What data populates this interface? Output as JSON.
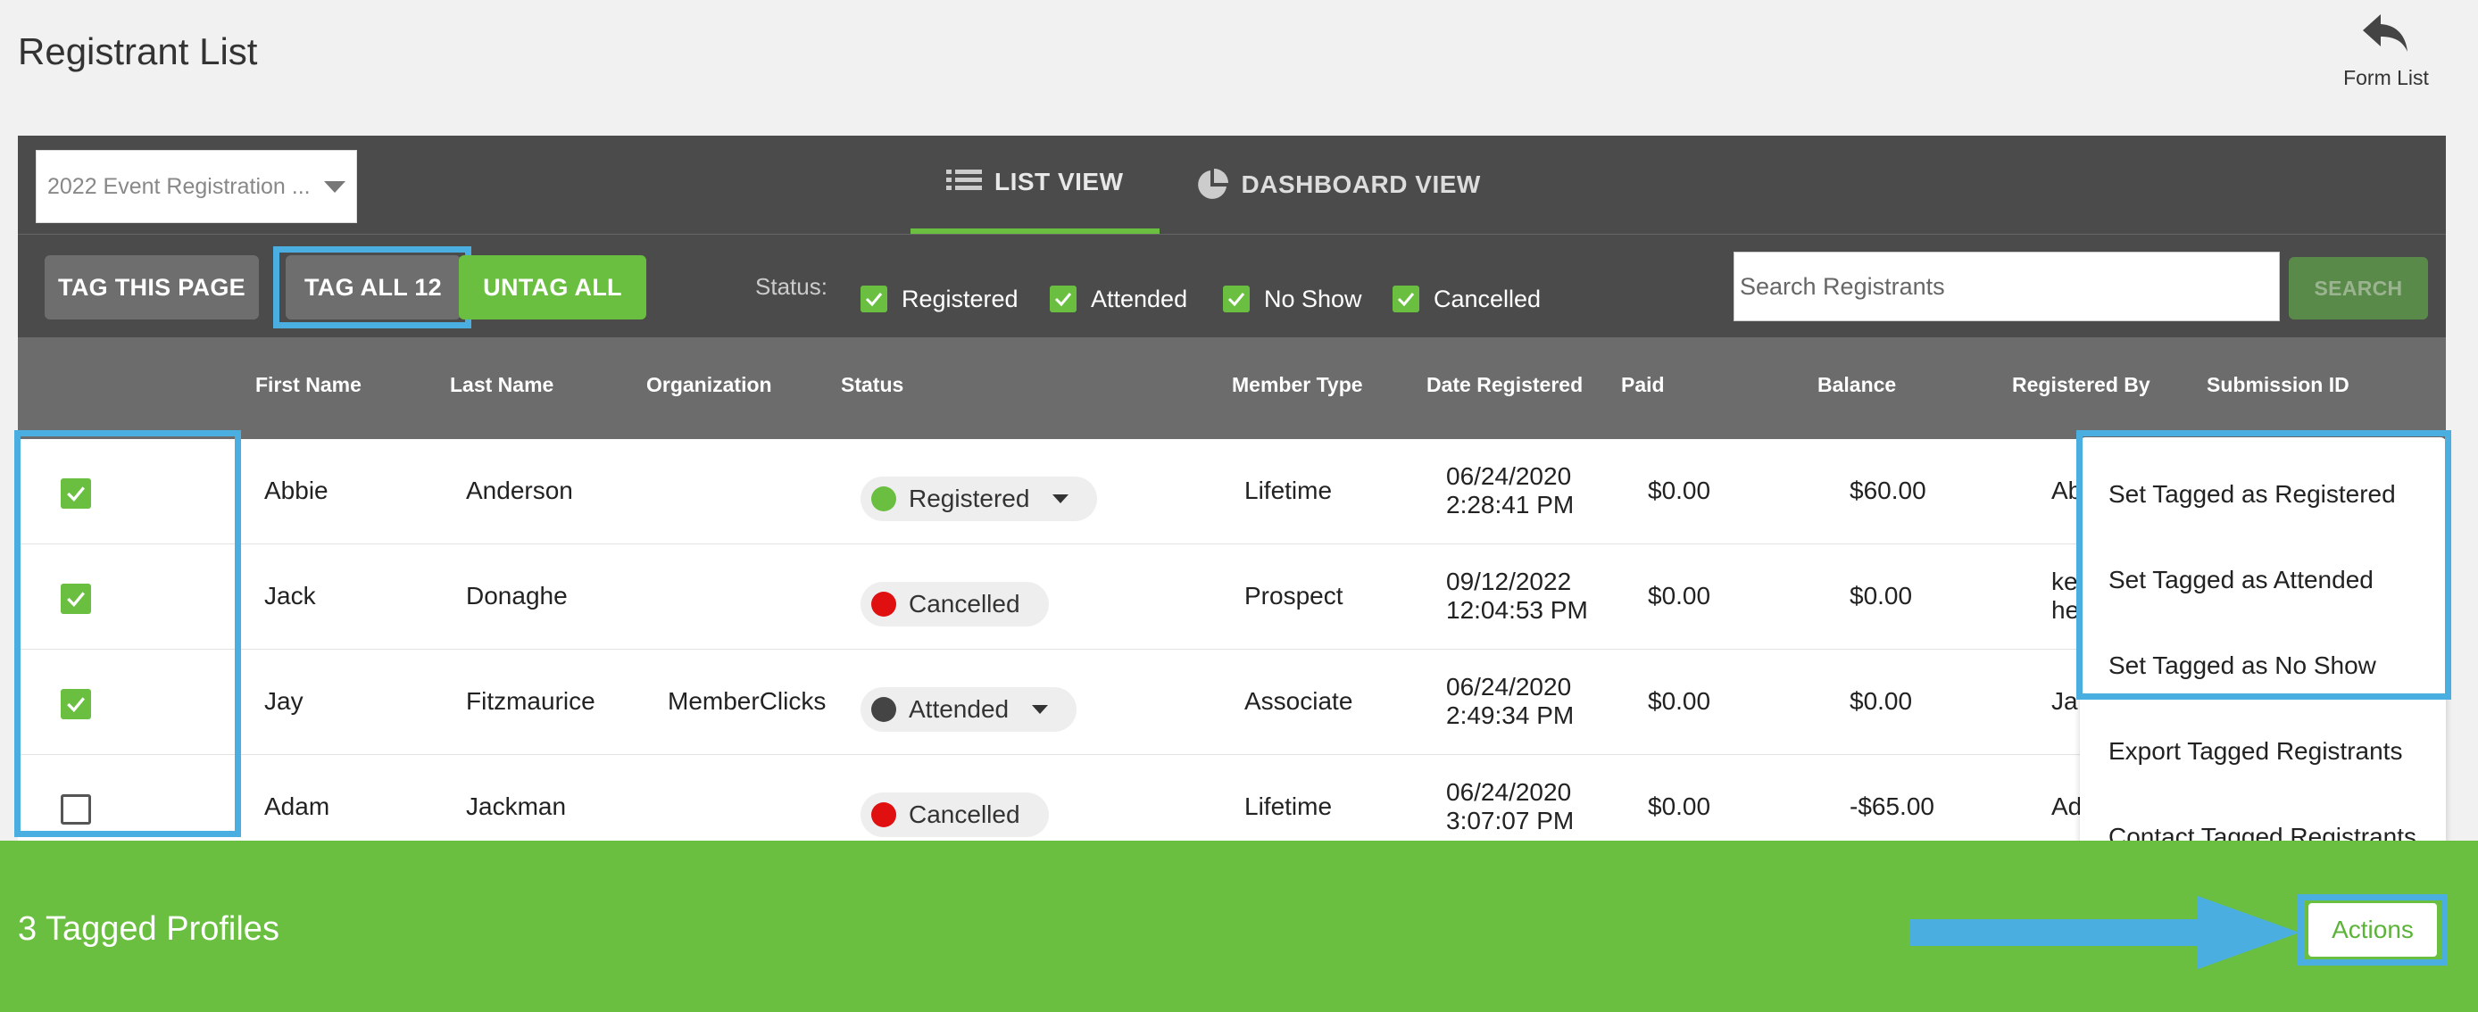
{
  "header": {
    "title": "Registrant List",
    "form_list_label": "Form List"
  },
  "toolbar": {
    "event_select_value": "2022 Event Registration ...",
    "tabs": [
      {
        "label": "LIST VIEW",
        "active": true
      },
      {
        "label": "DASHBOARD VIEW",
        "active": false
      }
    ],
    "tag_page_label": "TAG THIS PAGE",
    "tag_all_label": "TAG ALL 12",
    "untag_all_label": "UNTAG ALL",
    "status_label": "Status:",
    "status_filters": [
      {
        "label": "Registered",
        "checked": true
      },
      {
        "label": "Attended",
        "checked": true
      },
      {
        "label": "No Show",
        "checked": true
      },
      {
        "label": "Cancelled",
        "checked": true
      }
    ],
    "search_placeholder": "Search Registrants",
    "search_button_label": "SEARCH"
  },
  "table": {
    "columns": [
      "First Name",
      "Last Name",
      "Organization",
      "Status",
      "Member Type",
      "Date Registered",
      "Paid",
      "Balance",
      "Registered By",
      "Submission ID"
    ],
    "rows": [
      {
        "checked": true,
        "first": "Abbie",
        "last": "Anderson",
        "org": "",
        "status": "Registered",
        "status_dropdown": true,
        "member_type": "Lifetime",
        "date": "06/24/2020",
        "time": "2:28:41 PM",
        "paid": "$0.00",
        "balance": "$60.00",
        "registered_by_1": "Ab",
        "registered_by_2": ""
      },
      {
        "checked": true,
        "first": "Jack",
        "last": "Donaghe",
        "org": "",
        "status": "Cancelled",
        "status_dropdown": false,
        "member_type": "Prospect",
        "date": "09/12/2022",
        "time": "12:04:53 PM",
        "paid": "$0.00",
        "balance": "$0.00",
        "registered_by_1": "ke",
        "registered_by_2": "he"
      },
      {
        "checked": true,
        "first": "Jay",
        "last": "Fitzmaurice",
        "org": "MemberClicks",
        "status": "Attended",
        "status_dropdown": true,
        "member_type": "Associate",
        "date": "06/24/2020",
        "time": "2:49:34 PM",
        "paid": "$0.00",
        "balance": "$0.00",
        "registered_by_1": "Ja",
        "registered_by_2": ""
      },
      {
        "checked": false,
        "first": "Adam",
        "last": "Jackman",
        "org": "",
        "status": "Cancelled",
        "status_dropdown": false,
        "member_type": "Lifetime",
        "date": "06/24/2020",
        "time": "3:07:07 PM",
        "paid": "$0.00",
        "balance": "-$65.00",
        "registered_by_1": "Ad",
        "registered_by_2": ""
      }
    ]
  },
  "status_colors": {
    "Registered": "#6abf40",
    "Cancelled": "#e01010",
    "Attended": "#444444"
  },
  "actions_menu": {
    "items": [
      "Set Tagged as Registered",
      "Set Tagged as Attended",
      "Set Tagged as No Show",
      "Export Tagged Registrants",
      "Contact Tagged Registrants"
    ]
  },
  "footer": {
    "tagged_count_label": "3 Tagged Profiles",
    "actions_label": "Actions"
  },
  "colors": {
    "accent_green": "#6abf40",
    "highlight_blue": "#4aaee0",
    "panel_dark": "#4b4b4b"
  }
}
